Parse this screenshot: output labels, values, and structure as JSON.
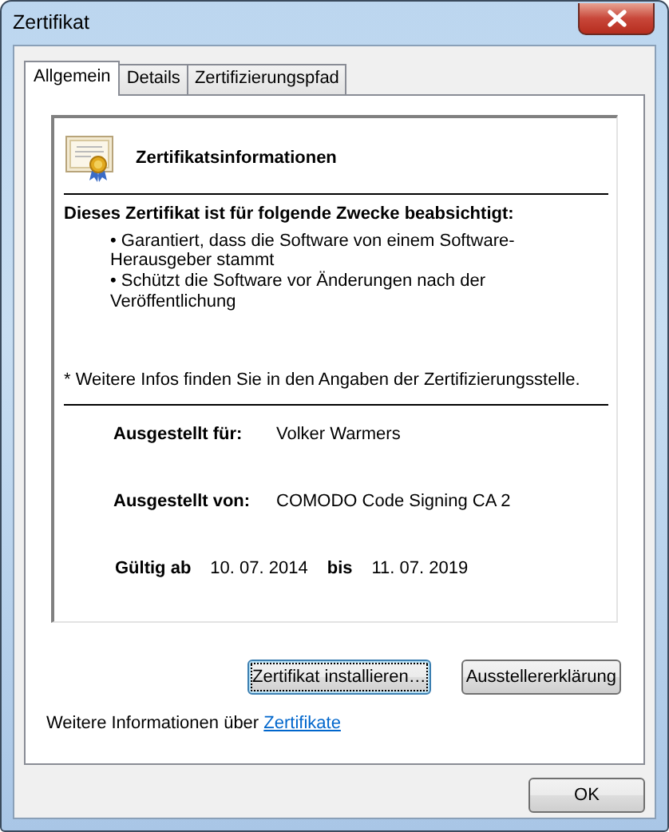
{
  "window": {
    "title": "Zertifikat"
  },
  "tabs": [
    {
      "label": "Allgemein",
      "selected": true
    },
    {
      "label": "Details",
      "selected": false
    },
    {
      "label": "Zertifizierungspfad",
      "selected": false
    }
  ],
  "certificate_info": {
    "heading": "Zertifikatsinformationen",
    "purposes_heading": "Dieses Zertifikat ist für folgende Zwecke beabsichtigt:",
    "purposes": [
      "• Garantiert, dass die Software von einem Software-Herausgeber stammt",
      "• Schützt die Software vor Änderungen nach der Veröffentlichung"
    ],
    "footnote": "* Weitere Infos finden Sie in den Angaben der Zertifizierungsstelle.",
    "fields": [
      {
        "label": "Ausgestellt für:",
        "value": "Volker Warmers"
      },
      {
        "label": "Ausgestellt von:",
        "value": "COMODO Code Signing CA 2"
      }
    ],
    "validity": {
      "from_label": "Gültig ab",
      "from": "10. 07. 2014",
      "to_label": "bis",
      "to": "11. 07. 2019"
    }
  },
  "buttons": [
    {
      "label": "Zertifikat installieren…",
      "focused": true
    },
    {
      "label": "Ausstellererklärung",
      "focused": false
    }
  ],
  "more_info": {
    "text": "Weitere Informationen über",
    "link": "Zertifikate"
  },
  "dialog_buttons": [
    {
      "label": "OK"
    }
  ]
}
